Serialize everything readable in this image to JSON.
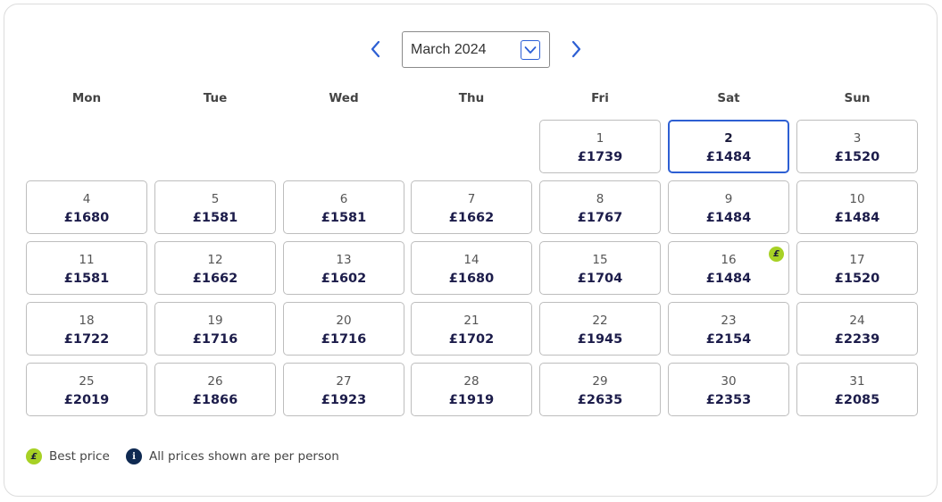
{
  "calendar": {
    "month_label": "March 2024",
    "weekdays": [
      "Mon",
      "Tue",
      "Wed",
      "Thu",
      "Fri",
      "Sat",
      "Sun"
    ],
    "selected_day": 2,
    "best_price_day": 16,
    "days": [
      {
        "day": "1",
        "price": "£1739"
      },
      {
        "day": "2",
        "price": "£1484"
      },
      {
        "day": "3",
        "price": "£1520"
      },
      {
        "day": "4",
        "price": "£1680"
      },
      {
        "day": "5",
        "price": "£1581"
      },
      {
        "day": "6",
        "price": "£1581"
      },
      {
        "day": "7",
        "price": "£1662"
      },
      {
        "day": "8",
        "price": "£1767"
      },
      {
        "day": "9",
        "price": "£1484"
      },
      {
        "day": "10",
        "price": "£1484"
      },
      {
        "day": "11",
        "price": "£1581"
      },
      {
        "day": "12",
        "price": "£1662"
      },
      {
        "day": "13",
        "price": "£1602"
      },
      {
        "day": "14",
        "price": "£1680"
      },
      {
        "day": "15",
        "price": "£1704"
      },
      {
        "day": "16",
        "price": "£1484"
      },
      {
        "day": "17",
        "price": "£1520"
      },
      {
        "day": "18",
        "price": "£1722"
      },
      {
        "day": "19",
        "price": "£1716"
      },
      {
        "day": "20",
        "price": "£1716"
      },
      {
        "day": "21",
        "price": "£1702"
      },
      {
        "day": "22",
        "price": "£1945"
      },
      {
        "day": "23",
        "price": "£2154"
      },
      {
        "day": "24",
        "price": "£2239"
      },
      {
        "day": "25",
        "price": "£2019"
      },
      {
        "day": "26",
        "price": "£1866"
      },
      {
        "day": "27",
        "price": "£1923"
      },
      {
        "day": "28",
        "price": "£1919"
      },
      {
        "day": "29",
        "price": "£2635"
      },
      {
        "day": "30",
        "price": "£2353"
      },
      {
        "day": "31",
        "price": "£2085"
      }
    ],
    "best_badge_symbol": "£"
  },
  "legend": {
    "best_price_symbol": "£",
    "best_price_label": "Best price",
    "info_symbol": "i",
    "info_label": "All prices shown are per person"
  },
  "colors": {
    "accent_blue": "#2d5fd3",
    "best_price_green": "#a7d125",
    "info_navy": "#0f2a52"
  },
  "icons": {
    "prev": "chevron-left-icon",
    "next": "chevron-right-icon",
    "dropdown": "chevron-down-icon"
  }
}
